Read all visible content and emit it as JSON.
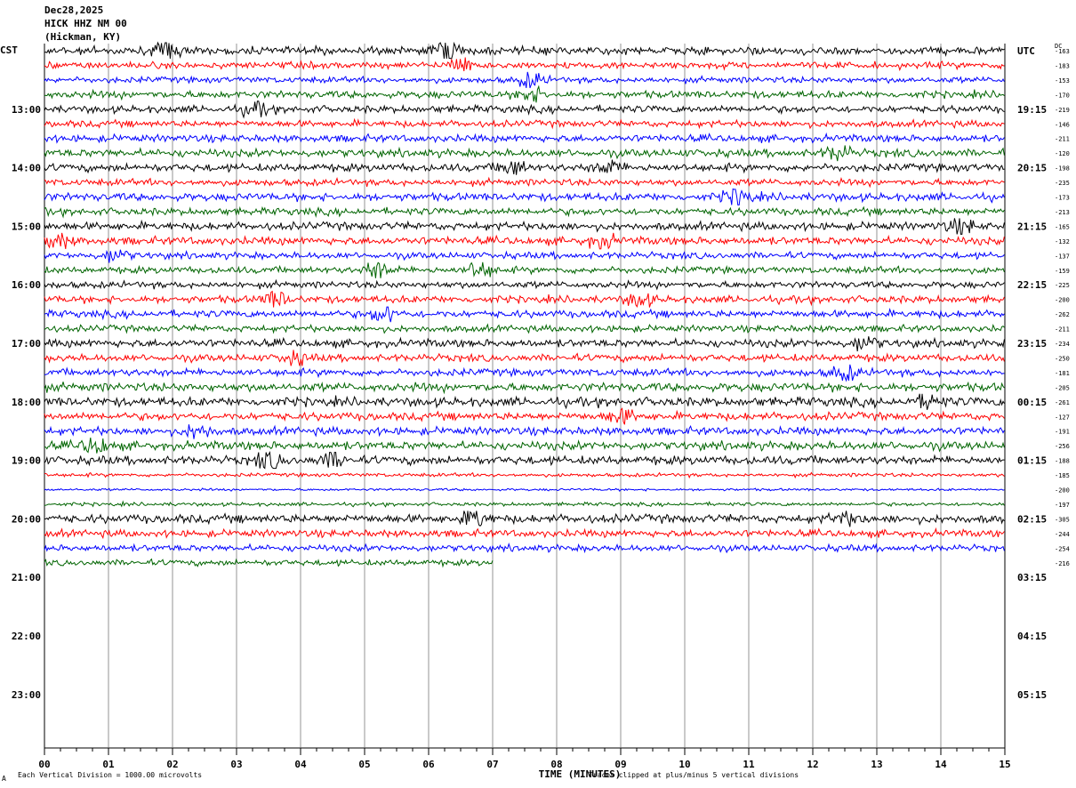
{
  "header": {
    "date": "Dec28,2025",
    "station": "HICK HHZ NM 00",
    "location": "(Hickman, KY)"
  },
  "left_timezone": "CST",
  "right_timezone": "UTC",
  "dc_label": "DC",
  "footer": {
    "xlabel": "TIME (MINUTES)",
    "scale_note": "Each Vertical Division = 1000.00 microvolts",
    "clip_note": "Traces clipped at plus/minus 5 vertical divisions",
    "corner_mark": "A"
  },
  "colors": {
    "trace_cycle": [
      "#000000",
      "#ff0000",
      "#0000ff",
      "#006400"
    ],
    "grid": "#666666",
    "background": "#ffffff"
  },
  "chart_data": {
    "type": "line",
    "title": "HICK HHZ NM 00 (Hickman, KY)",
    "xlabel": "TIME (MINUTES)",
    "x_ticks": [
      "00",
      "01",
      "02",
      "03",
      "04",
      "05",
      "06",
      "07",
      "08",
      "09",
      "10",
      "11",
      "12",
      "13",
      "14",
      "15"
    ],
    "xlim": [
      0,
      15
    ],
    "minutes_per_trace": 15,
    "total_rows": 36,
    "recorded_traces": 36,
    "last_trace_end_minute": 7,
    "left_hour_labels": [
      {
        "row": 4,
        "label": "13:00"
      },
      {
        "row": 8,
        "label": "14:00"
      },
      {
        "row": 12,
        "label": "15:00"
      },
      {
        "row": 16,
        "label": "16:00"
      },
      {
        "row": 20,
        "label": "17:00"
      },
      {
        "row": 24,
        "label": "18:00"
      },
      {
        "row": 28,
        "label": "19:00"
      },
      {
        "row": 32,
        "label": "20:00"
      },
      {
        "row": 36,
        "label": "21:00"
      },
      {
        "row": 40,
        "label": "22:00"
      },
      {
        "row": 44,
        "label": "23:00"
      }
    ],
    "right_hour_labels": [
      {
        "row": 0,
        "label": "UTC"
      },
      {
        "row": 4,
        "label": "19:15"
      },
      {
        "row": 8,
        "label": "20:15"
      },
      {
        "row": 12,
        "label": "21:15"
      },
      {
        "row": 16,
        "label": "22:15"
      },
      {
        "row": 20,
        "label": "23:15"
      },
      {
        "row": 24,
        "label": "00:15"
      },
      {
        "row": 28,
        "label": "01:15"
      },
      {
        "row": 32,
        "label": "02:15"
      },
      {
        "row": 36,
        "label": "03:15"
      },
      {
        "row": 40,
        "label": "04:15"
      },
      {
        "row": 44,
        "label": "05:15"
      }
    ],
    "dc_offsets": [
      -163,
      -183,
      -153,
      -170,
      -219,
      -146,
      -211,
      -120,
      -198,
      -235,
      -173,
      -213,
      -165,
      -132,
      -137,
      -159,
      -225,
      -200,
      -262,
      -211,
      -234,
      -250,
      -181,
      -205,
      -261,
      -127,
      -191,
      -256,
      -188,
      -185,
      -200,
      -197,
      -305,
      -244,
      -254,
      -216
    ],
    "activity": [
      1.3,
      1.1,
      1.0,
      1.2,
      1.2,
      1.1,
      1.2,
      1.3,
      1.3,
      1.1,
      1.3,
      1.2,
      1.3,
      1.3,
      1.1,
      1.1,
      1.1,
      1.2,
      1.2,
      1.1,
      1.3,
      1.2,
      1.2,
      1.4,
      1.5,
      1.3,
      1.3,
      1.4,
      1.4,
      0.6,
      0.4,
      0.6,
      1.4,
      1.2,
      1.1,
      1.0
    ],
    "bursts": [
      {
        "row": 0,
        "minute": 6.3,
        "amplitude": 2.6
      },
      {
        "row": 0,
        "minute": 1.9,
        "amplitude": 2.2
      },
      {
        "row": 1,
        "minute": 6.5,
        "amplitude": 1.8
      },
      {
        "row": 2,
        "minute": 7.6,
        "amplitude": 2.0
      },
      {
        "row": 3,
        "minute": 7.6,
        "amplitude": 2.0
      },
      {
        "row": 4,
        "minute": 3.3,
        "amplitude": 2.0
      },
      {
        "row": 7,
        "minute": 12.4,
        "amplitude": 1.8
      },
      {
        "row": 8,
        "minute": 7.3,
        "amplitude": 2.0
      },
      {
        "row": 8,
        "minute": 8.8,
        "amplitude": 2.0
      },
      {
        "row": 10,
        "minute": 10.8,
        "amplitude": 2.4
      },
      {
        "row": 12,
        "minute": 14.3,
        "amplitude": 2.2
      },
      {
        "row": 13,
        "minute": 0.2,
        "amplitude": 1.8
      },
      {
        "row": 13,
        "minute": 8.7,
        "amplitude": 1.8
      },
      {
        "row": 14,
        "minute": 1.1,
        "amplitude": 1.6
      },
      {
        "row": 15,
        "minute": 5.2,
        "amplitude": 2.4
      },
      {
        "row": 15,
        "minute": 6.8,
        "amplitude": 2.2
      },
      {
        "row": 17,
        "minute": 3.6,
        "amplitude": 2.0
      },
      {
        "row": 17,
        "minute": 9.3,
        "amplitude": 1.8
      },
      {
        "row": 18,
        "minute": 5.3,
        "amplitude": 2.0
      },
      {
        "row": 20,
        "minute": 12.8,
        "amplitude": 1.8
      },
      {
        "row": 21,
        "minute": 3.9,
        "amplitude": 2.0
      },
      {
        "row": 22,
        "minute": 12.5,
        "amplitude": 2.4
      },
      {
        "row": 24,
        "minute": 13.8,
        "amplitude": 2.2
      },
      {
        "row": 25,
        "minute": 9.0,
        "amplitude": 2.0
      },
      {
        "row": 26,
        "minute": 2.4,
        "amplitude": 1.8
      },
      {
        "row": 27,
        "minute": 0.8,
        "amplitude": 2.0
      },
      {
        "row": 28,
        "minute": 3.5,
        "amplitude": 2.2
      },
      {
        "row": 28,
        "minute": 4.5,
        "amplitude": 2.0
      },
      {
        "row": 32,
        "minute": 6.7,
        "amplitude": 2.6
      },
      {
        "row": 32,
        "minute": 12.5,
        "amplitude": 2.0
      }
    ]
  }
}
